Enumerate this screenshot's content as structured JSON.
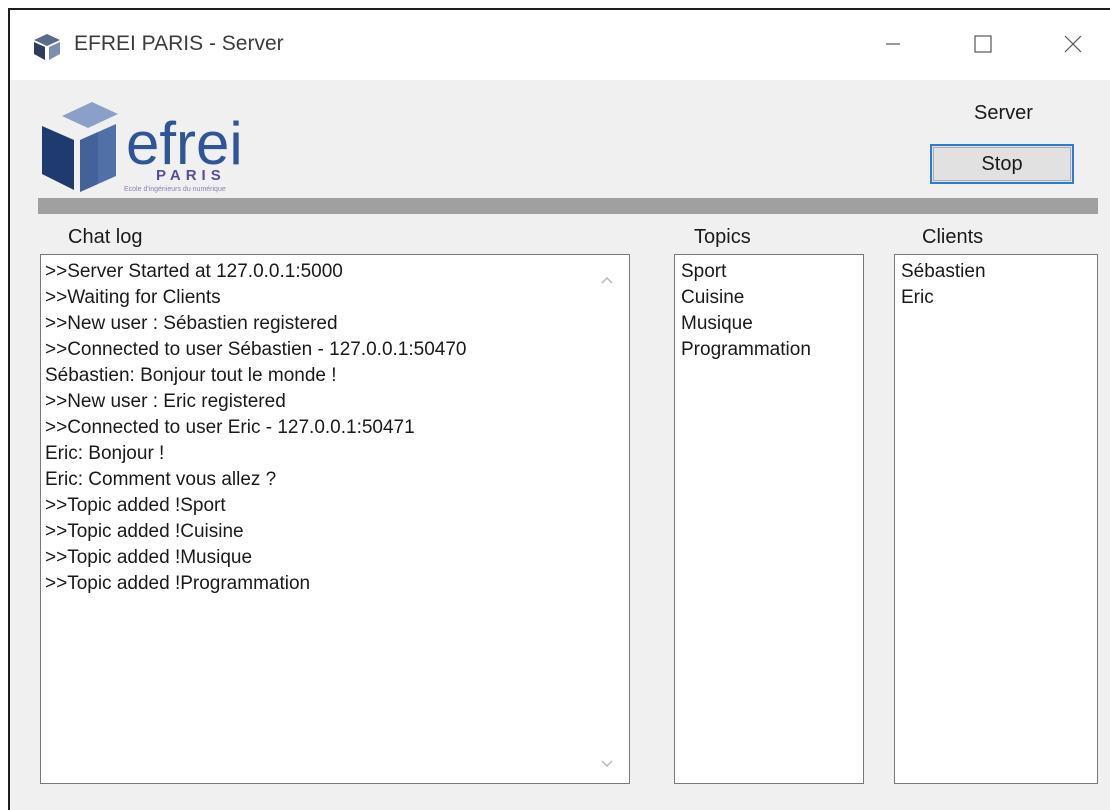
{
  "window": {
    "title": "EFREI PARIS - Server"
  },
  "logo": {
    "word": "efrei",
    "city": "PARIS",
    "tagline": "Ecole d'ingénieurs du numérique"
  },
  "server": {
    "label": "Server",
    "stop_label": "Stop"
  },
  "labels": {
    "chat_log": "Chat log",
    "topics": "Topics",
    "clients": "Clients"
  },
  "chat_log": [
    ">>Server Started at 127.0.0.1:5000",
    ">>Waiting for Clients",
    ">>New user : Sébastien registered",
    ">>Connected to user Sébastien - 127.0.0.1:50470",
    "Sébastien: Bonjour tout le monde !",
    ">>New user : Eric registered",
    ">>Connected to user Eric - 127.0.0.1:50471",
    "Eric: Bonjour !",
    "Eric: Comment vous allez ?",
    ">>Topic added !Sport",
    ">>Topic added !Cuisine",
    ">>Topic added !Musique",
    ">>Topic added !Programmation"
  ],
  "topics": [
    "Sport",
    "Cuisine",
    "Musique",
    "Programmation"
  ],
  "clients": [
    "Sébastien",
    "Eric"
  ],
  "colors": {
    "logo_blue": "#2f5597",
    "logo_purple": "#5b4a9e",
    "focus_border": "#2b7cd3"
  }
}
